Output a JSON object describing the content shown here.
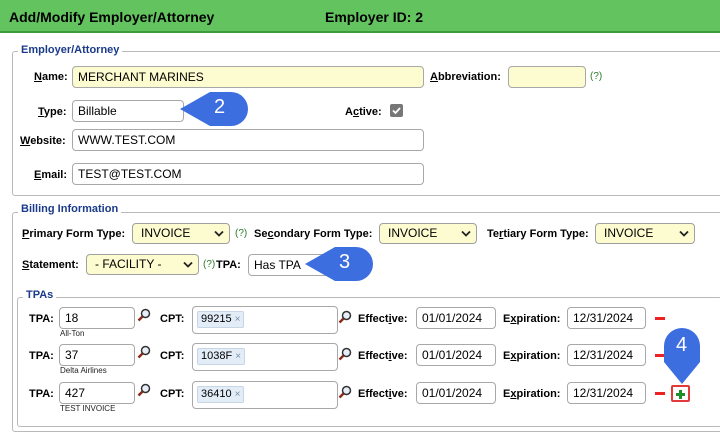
{
  "header": {
    "title": "Add/Modify Employer/Attorney",
    "employer_id": "Employer ID: 2"
  },
  "employer_section": {
    "legend": "Employer/Attorney",
    "name_label": "Name:",
    "name_value": "MERCHANT MARINES",
    "abbreviation_label": "Abbreviation:",
    "abbreviation_value": "",
    "help": "(?)",
    "type_label": "Type:",
    "type_value": "Billable",
    "active_label": "Active:",
    "active_checked": true,
    "website_label": "Website:",
    "website_value": "WWW.TEST.COM",
    "email_label": "Email:",
    "email_value": "TEST@TEST.COM"
  },
  "billing_section": {
    "legend": "Billing Information",
    "primary_label": "Primary Form Type:",
    "primary_value": "INVOICE",
    "secondary_label": "Secondary Form Type:",
    "secondary_value": "INVOICE",
    "tertiary_label": "Tertiary Form Type:",
    "tertiary_value": "INVOICE",
    "statement_label": "Statement:",
    "statement_value": "- FACILITY -",
    "help": "(?)",
    "tpa_label": "TPA:",
    "tpa_value": "Has TPA"
  },
  "tpas_section": {
    "legend": "TPAs",
    "rows": [
      {
        "tpa_label": "TPA:",
        "tpa_value": "18",
        "tpa_name": "All-Ton",
        "cpt_label": "CPT:",
        "cpt_chip": "99215",
        "chip_x": "×",
        "effective_label": "Effective:",
        "effective_value": "01/01/2024",
        "expiration_label": "Expiration:",
        "expiration_value": "12/31/2024"
      },
      {
        "tpa_label": "TPA:",
        "tpa_value": "37",
        "tpa_name": "Delta Airlines",
        "cpt_label": "CPT:",
        "cpt_chip": "1038F",
        "chip_x": "×",
        "effective_label": "Effective:",
        "effective_value": "01/01/2024",
        "expiration_label": "Expiration:",
        "expiration_value": "12/31/2024"
      },
      {
        "tpa_label": "TPA:",
        "tpa_value": "427",
        "tpa_name": "TEST INVOICE",
        "cpt_label": "CPT:",
        "cpt_chip": "36410",
        "chip_x": "×",
        "effective_label": "Effective:",
        "effective_value": "01/01/2024",
        "expiration_label": "Expiration:",
        "expiration_value": "12/31/2024"
      }
    ]
  },
  "annotations": [
    {
      "number": "2",
      "color": "#3d6ee0"
    },
    {
      "number": "3",
      "color": "#3d6ee0"
    },
    {
      "number": "4",
      "color": "#3d6ee0"
    }
  ],
  "icons": [
    "magnifier-icon",
    "chevron-down-icon",
    "checkmark-icon",
    "minus-icon",
    "plus-icon",
    "chip-remove-icon"
  ],
  "colors": {
    "header_green": "#63c35f",
    "input_yellow": "#fdfbd0",
    "legend_blue": "#1a3a8a",
    "remove_red": "#e22222",
    "add_green": "#1c8f2b"
  }
}
